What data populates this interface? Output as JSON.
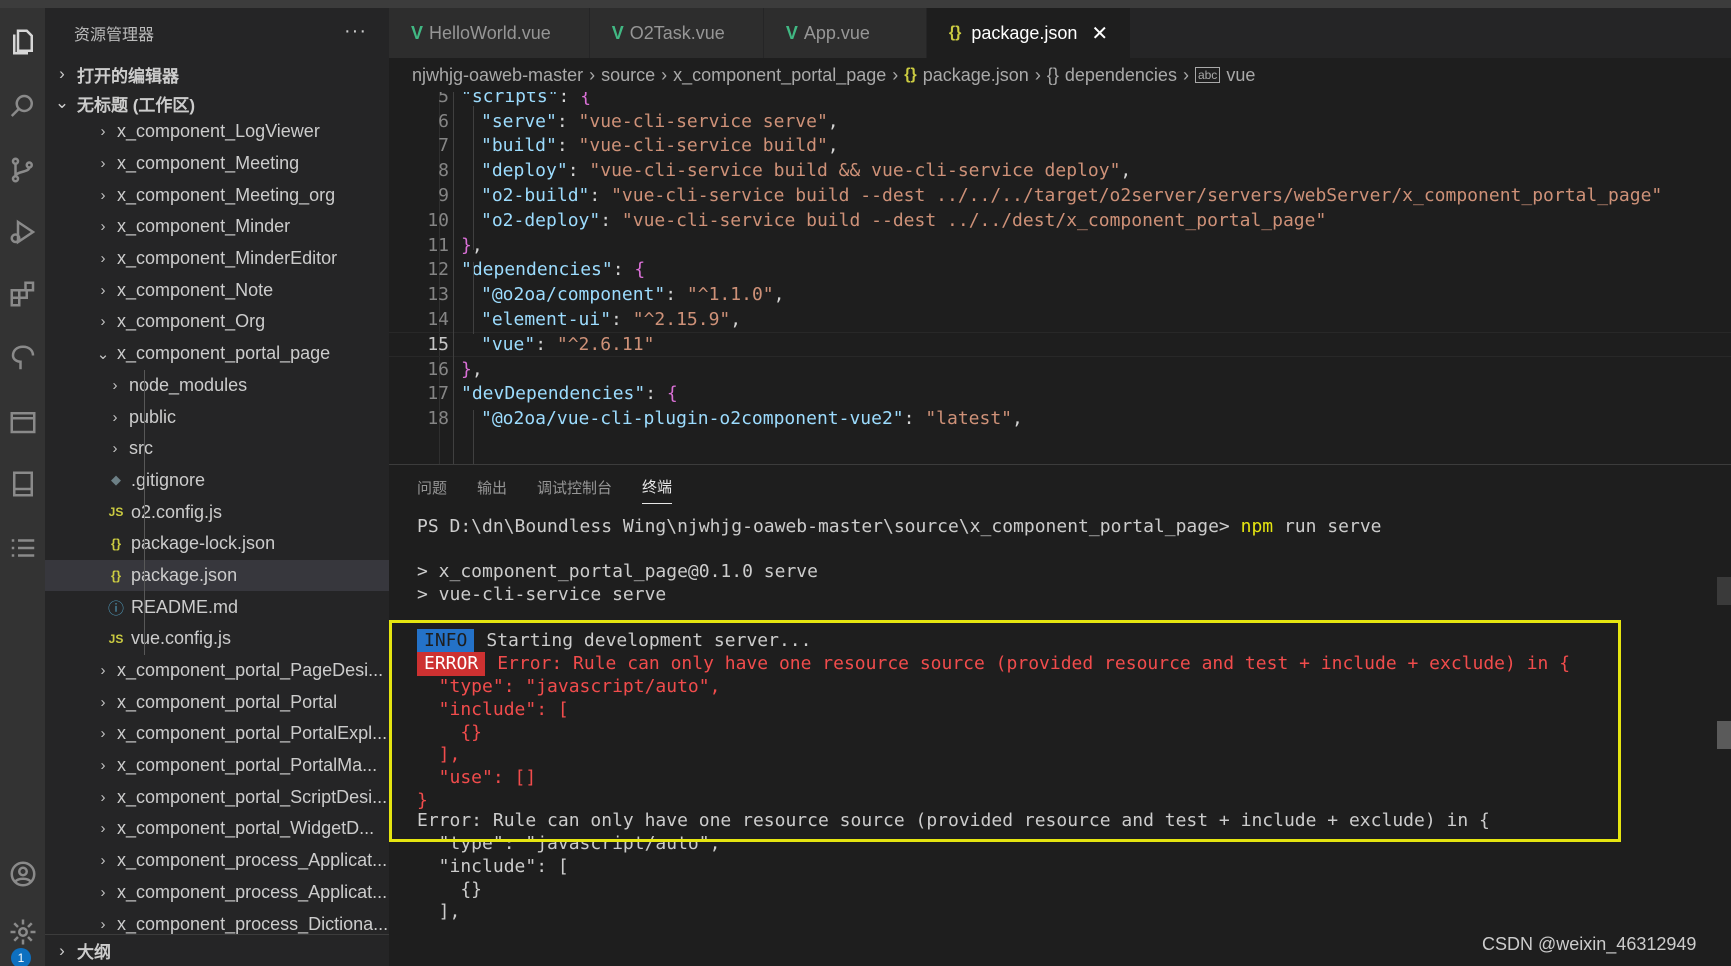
{
  "sidebar": {
    "title": "资源管理器",
    "more": "···",
    "open_editors": "打开的编辑器",
    "workspace": "无标题 (工作区)",
    "outline": "大纲",
    "items": [
      {
        "label": "x_component_LogViewer",
        "level": 1,
        "chev": "›",
        "icon": ""
      },
      {
        "label": "x_component_Meeting",
        "level": 1,
        "chev": "›",
        "icon": ""
      },
      {
        "label": "x_component_Meeting_org",
        "level": 1,
        "chev": "›",
        "icon": ""
      },
      {
        "label": "x_component_Minder",
        "level": 1,
        "chev": "›",
        "icon": ""
      },
      {
        "label": "x_component_MinderEditor",
        "level": 1,
        "chev": "›",
        "icon": ""
      },
      {
        "label": "x_component_Note",
        "level": 1,
        "chev": "›",
        "icon": ""
      },
      {
        "label": "x_component_Org",
        "level": 1,
        "chev": "›",
        "icon": ""
      },
      {
        "label": "x_component_portal_page",
        "level": 1,
        "chev": "⌄",
        "icon": ""
      },
      {
        "label": "node_modules",
        "level": 2,
        "chev": "›",
        "icon": ""
      },
      {
        "label": "public",
        "level": 2,
        "chev": "›",
        "icon": ""
      },
      {
        "label": "src",
        "level": 2,
        "chev": "›",
        "icon": ""
      },
      {
        "label": ".gitignore",
        "level": 2,
        "chev": "",
        "icon": "◆"
      },
      {
        "label": "o2.config.js",
        "level": 2,
        "chev": "",
        "icon": "JS"
      },
      {
        "label": "package-lock.json",
        "level": 2,
        "chev": "",
        "icon": "{}"
      },
      {
        "label": "package.json",
        "level": 2,
        "chev": "",
        "icon": "{}",
        "selected": true
      },
      {
        "label": "README.md",
        "level": 2,
        "chev": "",
        "icon": "ⓘ"
      },
      {
        "label": "vue.config.js",
        "level": 2,
        "chev": "",
        "icon": "JS"
      },
      {
        "label": "x_component_portal_PageDesi...",
        "level": 1,
        "chev": "›",
        "icon": ""
      },
      {
        "label": "x_component_portal_Portal",
        "level": 1,
        "chev": "›",
        "icon": ""
      },
      {
        "label": "x_component_portal_PortalExpl...",
        "level": 1,
        "chev": "›",
        "icon": ""
      },
      {
        "label": "x_component_portal_PortalMa...",
        "level": 1,
        "chev": "›",
        "icon": ""
      },
      {
        "label": "x_component_portal_ScriptDesi...",
        "level": 1,
        "chev": "›",
        "icon": ""
      },
      {
        "label": "x_component_portal_WidgetD...",
        "level": 1,
        "chev": "›",
        "icon": ""
      },
      {
        "label": "x_component_process_Applicat...",
        "level": 1,
        "chev": "›",
        "icon": ""
      },
      {
        "label": "x_component_process_Applicat...",
        "level": 1,
        "chev": "›",
        "icon": ""
      },
      {
        "label": "x_component_process_Dictiona...",
        "level": 1,
        "chev": "›",
        "icon": ""
      }
    ]
  },
  "activity": {
    "badge": "1",
    "icons": [
      "files-icon",
      "search-icon",
      "source-control-icon",
      "run-debug-icon",
      "extensions-icon",
      "remote-icon",
      "browser-icon",
      "book-icon",
      "list-icon",
      "account-icon",
      "settings-gear-icon"
    ]
  },
  "tabs": [
    {
      "label": "HelloWorld.vue",
      "kind": "vue"
    },
    {
      "label": "O2Task.vue",
      "kind": "vue"
    },
    {
      "label": "App.vue",
      "kind": "vue"
    },
    {
      "label": "package.json",
      "kind": "json",
      "active": true,
      "close": "✕"
    }
  ],
  "breadcrumb": {
    "parts": [
      "njwhjg-oaweb-master",
      "source",
      "x_component_portal_page",
      "package.json",
      "dependencies",
      "vue"
    ]
  },
  "editor": {
    "current_line": 15,
    "lines": [
      {
        "n": "5",
        "indent": 1,
        "tokens": [
          [
            "k",
            "\"scripts\""
          ],
          [
            "p",
            ": "
          ],
          [
            "b1",
            "{"
          ]
        ]
      },
      {
        "n": "6",
        "indent": 2,
        "tokens": [
          [
            "k",
            "\"serve\""
          ],
          [
            "p",
            ": "
          ],
          [
            "s",
            "\"vue-cli-service serve\""
          ],
          [
            "p",
            ","
          ]
        ]
      },
      {
        "n": "7",
        "indent": 2,
        "tokens": [
          [
            "k",
            "\"build\""
          ],
          [
            "p",
            ": "
          ],
          [
            "s",
            "\"vue-cli-service build\""
          ],
          [
            "p",
            ","
          ]
        ]
      },
      {
        "n": "8",
        "indent": 2,
        "tokens": [
          [
            "k",
            "\"deploy\""
          ],
          [
            "p",
            ": "
          ],
          [
            "s",
            "\"vue-cli-service build && vue-cli-service deploy\""
          ],
          [
            "p",
            ","
          ]
        ]
      },
      {
        "n": "9",
        "indent": 2,
        "tokens": [
          [
            "k",
            "\"o2-build\""
          ],
          [
            "p",
            ": "
          ],
          [
            "s",
            "\"vue-cli-service build --dest ../../../target/o2server/servers/webServer/x_component_portal_page\""
          ]
        ]
      },
      {
        "n": "10",
        "indent": 2,
        "tokens": [
          [
            "k",
            "\"o2-deploy\""
          ],
          [
            "p",
            ": "
          ],
          [
            "s",
            "\"vue-cli-service build --dest ../../dest/x_component_portal_page\""
          ]
        ]
      },
      {
        "n": "11",
        "indent": 1,
        "tokens": [
          [
            "b1",
            "}"
          ],
          [
            "p",
            ","
          ]
        ]
      },
      {
        "n": "12",
        "indent": 1,
        "tokens": [
          [
            "k",
            "\"dependencies\""
          ],
          [
            "p",
            ": "
          ],
          [
            "b1",
            "{"
          ]
        ]
      },
      {
        "n": "13",
        "indent": 2,
        "tokens": [
          [
            "k",
            "\"@o2oa/component\""
          ],
          [
            "p",
            ": "
          ],
          [
            "s",
            "\"^1.1.0\""
          ],
          [
            "p",
            ","
          ]
        ]
      },
      {
        "n": "14",
        "indent": 2,
        "tokens": [
          [
            "k",
            "\"element-ui\""
          ],
          [
            "p",
            ": "
          ],
          [
            "s",
            "\"^2.15.9\""
          ],
          [
            "p",
            ","
          ]
        ]
      },
      {
        "n": "15",
        "indent": 2,
        "tokens": [
          [
            "k",
            "\"vue\""
          ],
          [
            "p",
            ": "
          ],
          [
            "s",
            "\"^2.6.11\""
          ]
        ]
      },
      {
        "n": "16",
        "indent": 1,
        "tokens": [
          [
            "b1",
            "}"
          ],
          [
            "p",
            ","
          ]
        ]
      },
      {
        "n": "17",
        "indent": 1,
        "tokens": [
          [
            "k",
            "\"devDependencies\""
          ],
          [
            "p",
            ": "
          ],
          [
            "b1",
            "{"
          ]
        ]
      },
      {
        "n": "18",
        "indent": 2,
        "tokens": [
          [
            "k",
            "\"@o2oa/vue-cli-plugin-o2component-vue2\""
          ],
          [
            "p",
            ": "
          ],
          [
            "s",
            "\"latest\""
          ],
          [
            "p",
            ","
          ]
        ]
      }
    ]
  },
  "panel": {
    "tabs": [
      "问题",
      "输出",
      "调试控制台",
      "终端"
    ],
    "active_tab": "终端",
    "prompt": "PS D:\\dn\\Boundless Wing\\njwhjg-oaweb-master\\source\\x_component_portal_page> ",
    "cmd_npm": "npm",
    "cmd_rest": " run serve",
    "script_line1": "> x_component_portal_page@0.1.0 serve",
    "script_line2": "> vue-cli-service serve",
    "info_tag": "INFO",
    "info_text": "Starting development server...",
    "error_tag": "ERROR",
    "error_text": "Error: Rule can only have one resource source (provided resource and test + include + exclude) in {",
    "err_block": [
      "  \"type\": \"javascript/auto\",",
      "  \"include\": [",
      "    {}",
      "  ],",
      "  \"use\": []",
      "}"
    ],
    "plain_error": "Error: Rule can only have one resource source (provided resource and test + include + exclude) in {",
    "plain_block": [
      "  \"type\": \"javascript/auto\",",
      "  \"include\": [",
      "    {}",
      "  ],"
    ]
  },
  "watermark": "CSDN @weixin_46312949"
}
